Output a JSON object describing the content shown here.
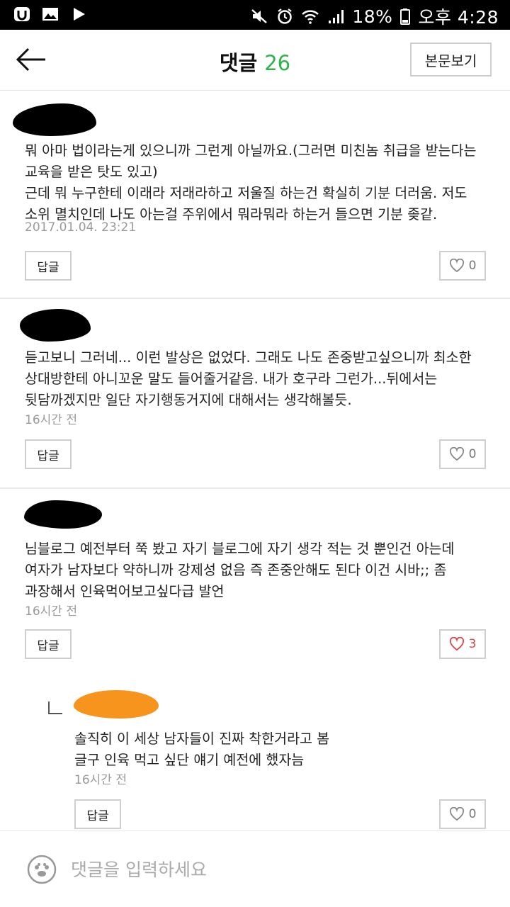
{
  "status_bar": {
    "battery": "18%",
    "time": "오후 4:28"
  },
  "header": {
    "title": "댓글",
    "count": "26",
    "view_post_label": "본문보기"
  },
  "comments": [
    {
      "text": "뭐 아마 법이라는게 있으니까 그런게 아닐까요.(그러면 미친놈 취급을 받는다는 교육을 받은 탓도 있고)\n근데 뭐 누구한테 이래라 저래라하고 저울질 하는건 확실히 기분 더러움. 저도 소위 멸치인데 나도 아는걸 주위에서 뭐라뭐라 하는거 들으면 기분 좆같.",
      "date": "2017.01.04. 23:21",
      "reply_label": "답글",
      "likes": "0"
    },
    {
      "text": "듣고보니 그러네... 이런 발상은 없었다. 그래도 나도 존중받고싶으니까 최소한 상대방한테 아니꼬운 말도 들어줄거같음. 내가 호구라 그런가...뒤에서는 뒷담까겠지만 일단 자기행동거지에 대해서는 생각해볼듯.",
      "date": "16시간 전",
      "reply_label": "답글",
      "likes": "0"
    },
    {
      "text": "님블로그 예전부터 쭉 봤고 자기 블로그에 자기 생각 적는 것 뿐인건 아는데 여자가 남자보다 약하니까 강제성 없음 즉 존중안해도 된다 이건 시바;; 좀 과장해서 인육먹어보고싶다급 발언",
      "date": "16시간 전",
      "reply_label": "답글",
      "likes": "3"
    }
  ],
  "reply": {
    "text": "솔직히 이 세상 남자들이 진짜 착한거라고 봄\n글구 인육 먹고 싶단 얘기 예전에 했자늠",
    "date": "16시간 전",
    "reply_label": "답글",
    "likes": "0"
  },
  "input": {
    "placeholder": "댓글을 입력하세요"
  },
  "colors": {
    "accent_green": "#2eb34a",
    "like_red": "#e04545",
    "avatar_orange": "#f7941d"
  }
}
